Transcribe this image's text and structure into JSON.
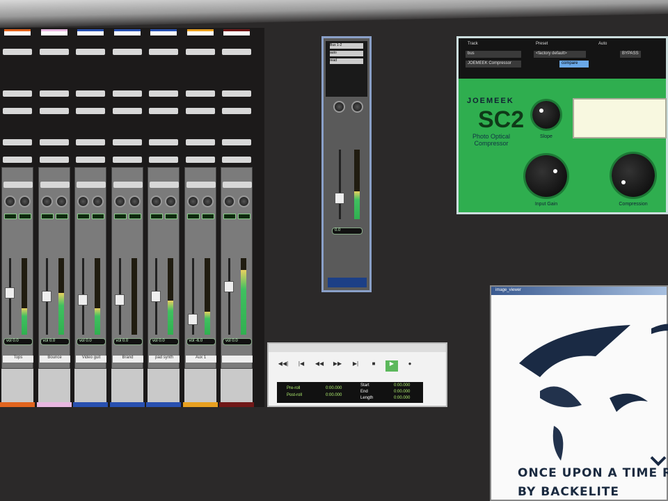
{
  "mixer": {
    "channels": [
      {
        "name": "Tops",
        "color": "#e0641e",
        "fader": 0.55,
        "meter": 0.35,
        "vol": "0.0"
      },
      {
        "name": "Bounce",
        "color": "#e8b8e0",
        "fader": 0.5,
        "meter": 0.55,
        "vol": "0.0"
      },
      {
        "name": "Video guit",
        "color": "#2850b0",
        "fader": 0.45,
        "meter": 0.35,
        "vol": "0.0"
      },
      {
        "name": "Brand",
        "color": "#2850b0",
        "fader": 0.45,
        "meter": 0.0,
        "vol": "0.0"
      },
      {
        "name": "pad synth",
        "color": "#2850b0",
        "fader": 0.5,
        "meter": 0.45,
        "vol": "0.0"
      },
      {
        "name": "Aux 1",
        "color": "#e8a020",
        "fader": 0.15,
        "meter": 0.3,
        "vol": "-6.0"
      },
      {
        "name": "",
        "color": "#701818",
        "fader": 0.65,
        "meter": 0.85,
        "vol": "0.0"
      }
    ],
    "vol_label": "vol"
  },
  "single_strip": {
    "labels": [
      "Bus 1-2",
      "auto",
      "read"
    ],
    "vol": "0.0"
  },
  "plugin": {
    "track_label": "Track",
    "preset_label": "Preset",
    "auto_label": "Auto",
    "track_value": "bus",
    "plugin_name": "JOEMEEK Compressor",
    "preset_value": "<factory default>",
    "compare": "compare",
    "bypass": "BYPASS",
    "brand": "JOEMEEK",
    "model": "SC2",
    "subtitle": "Photo Optical Compressor",
    "knobs": {
      "slope": "Slope",
      "input_gain": "Input Gain",
      "compression": "Compression"
    }
  },
  "transport": {
    "buttons": [
      "◀◀|",
      "|◀",
      "◀◀",
      "▶▶",
      "▶|",
      "■",
      "▶",
      "●"
    ],
    "pre_roll": "Pre-roll",
    "post_roll": "Post-roll",
    "pre_val": "0:00.000",
    "post_val": "0:00.000",
    "start": "Start",
    "end": "End",
    "length": "Length",
    "start_val": "0:00.000",
    "end_val": "0:00.000",
    "length_val": "0:00.000"
  },
  "viewer": {
    "title": "image_viewer",
    "caption_line1": "ONCE UPON A TIME RE",
    "caption_line2": "BY BACKELITE"
  }
}
